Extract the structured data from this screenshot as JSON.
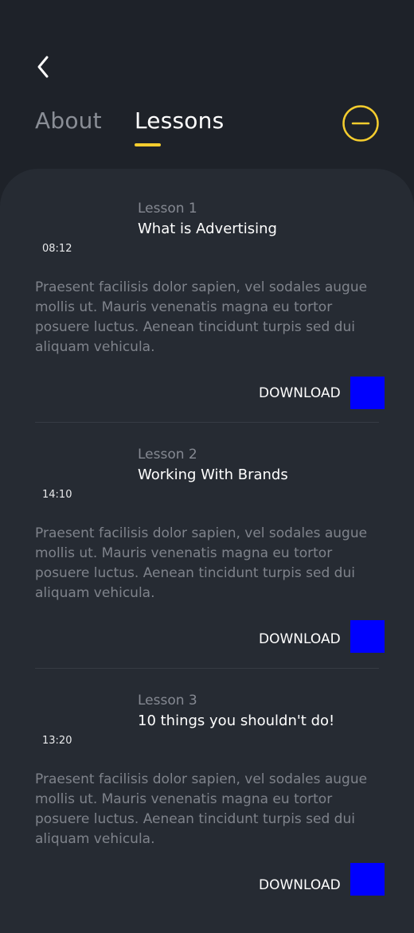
{
  "colors": {
    "background": "#1e2229",
    "panel": "#262b33",
    "accent": "#f5cd2e",
    "muted_text": "#858992",
    "download_icon": "#0000ff"
  },
  "header": {
    "back_icon": "chevron-left-icon",
    "tabs": [
      {
        "label": "About",
        "active": false
      },
      {
        "label": "Lessons",
        "active": true
      }
    ],
    "action_icon": "minus-circle-icon"
  },
  "lessons": [
    {
      "number": "Lesson 1",
      "title": "What is Advertising",
      "duration": "08:12",
      "description": "Praesent facilisis dolor sapien, vel sodales augue mollis ut. Mauris venenatis magna eu tortor posuere luctus. Aenean tincidunt turpis sed dui aliquam vehicula.",
      "download_label": "DOWNLOAD"
    },
    {
      "number": "Lesson 2",
      "title": "Working With Brands",
      "duration": "14:10",
      "description": "Praesent facilisis dolor sapien, vel sodales augue mollis ut. Mauris venenatis magna eu tortor posuere luctus. Aenean tincidunt turpis sed dui aliquam vehicula.",
      "download_label": "DOWNLOAD"
    },
    {
      "number": "Lesson 3",
      "title": "10 things you shouldn't do!",
      "duration": "13:20",
      "description": "Praesent facilisis dolor sapien, vel sodales augue mollis ut. Mauris venenatis magna eu tortor posuere luctus. Aenean tincidunt turpis sed dui aliquam vehicula.",
      "download_label": "DOWNLOAD"
    }
  ]
}
